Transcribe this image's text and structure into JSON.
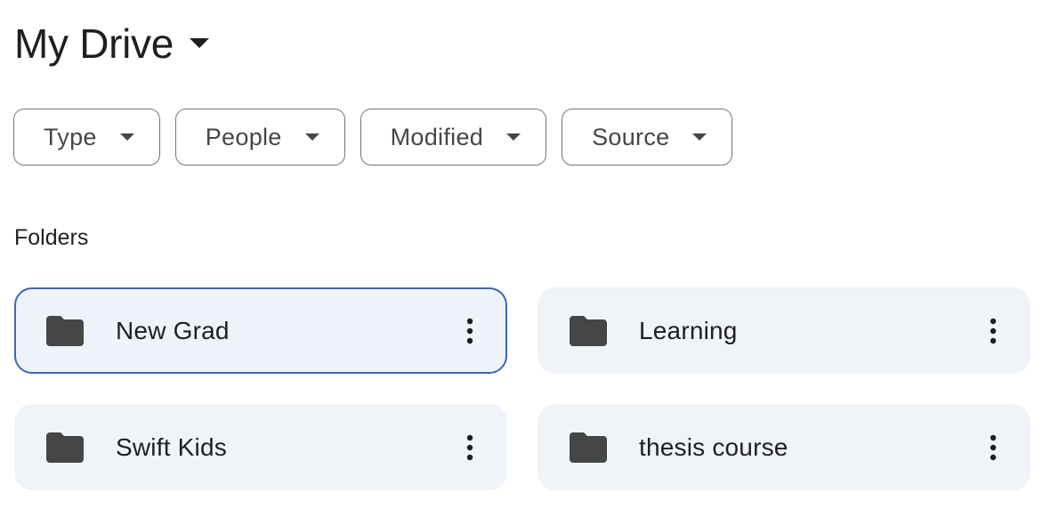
{
  "header": {
    "title": "My Drive",
    "title_icon": "arrow-drop-down-icon"
  },
  "filters": [
    {
      "label": "Type",
      "icon": "arrow-drop-down-icon"
    },
    {
      "label": "People",
      "icon": "arrow-drop-down-icon"
    },
    {
      "label": "Modified",
      "icon": "arrow-drop-down-icon"
    },
    {
      "label": "Source",
      "icon": "arrow-drop-down-icon"
    }
  ],
  "folders_section": {
    "label": "Folders",
    "items": [
      {
        "name": "New Grad",
        "selected": true,
        "icon": "folder-icon",
        "menu_icon": "more-vert-icon"
      },
      {
        "name": "Learning",
        "selected": false,
        "icon": "folder-icon",
        "menu_icon": "more-vert-icon"
      },
      {
        "name": "Swift Kids",
        "selected": false,
        "icon": "folder-icon",
        "menu_icon": "more-vert-icon"
      },
      {
        "name": "thesis course",
        "selected": false,
        "icon": "folder-icon",
        "menu_icon": "more-vert-icon"
      }
    ]
  },
  "colors": {
    "text_primary": "#1f1f1f",
    "chip_text": "#444746",
    "chip_border": "#747775",
    "card_background": "#f0f4f9",
    "selected_border": "#3f64b5",
    "folder_icon": "#444746"
  }
}
